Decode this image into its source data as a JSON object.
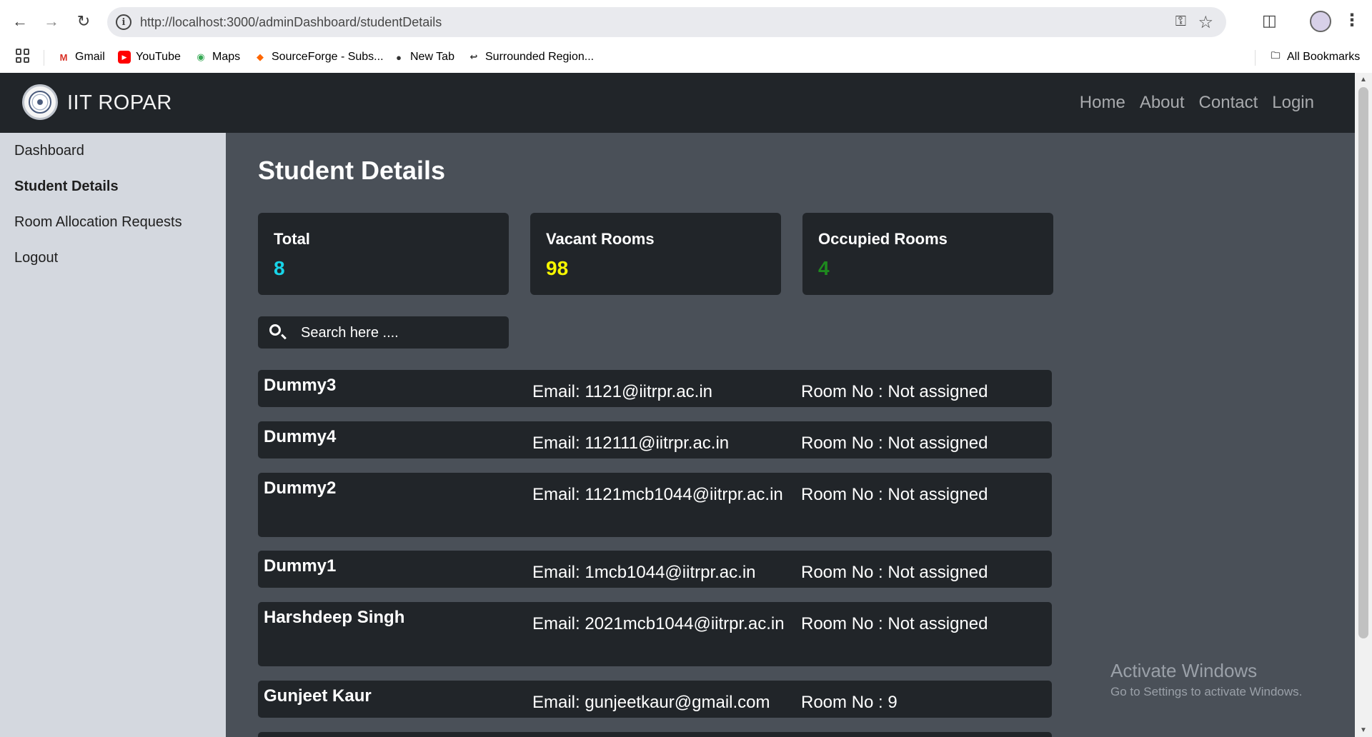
{
  "browser": {
    "url": "http://localhost:3000/adminDashboard/studentDetails",
    "bookmarks": [
      {
        "label": "Gmail",
        "icon": "gmail-icon",
        "color": "#d93025"
      },
      {
        "label": "YouTube",
        "icon": "youtube-icon",
        "color": "#ff0000"
      },
      {
        "label": "Maps",
        "icon": "maps-icon",
        "color": "#34a853"
      },
      {
        "label": "SourceForge - Subs...",
        "icon": "sourceforge-icon",
        "color": "#ff6600"
      },
      {
        "label": "New Tab",
        "icon": "globe-icon",
        "color": "#333333"
      },
      {
        "label": "Surrounded Region...",
        "icon": "leetcode-icon",
        "color": "#333333"
      }
    ],
    "all_bookmarks": "All Bookmarks"
  },
  "navbar": {
    "brand": "IIT ROPAR",
    "links": [
      "Home",
      "About",
      "Contact",
      "Login"
    ]
  },
  "sidebar": {
    "items": [
      {
        "label": "Dashboard",
        "active": false
      },
      {
        "label": "Student Details",
        "active": true
      },
      {
        "label": "Room Allocation Requests",
        "active": false
      },
      {
        "label": "Logout",
        "active": false
      }
    ]
  },
  "main": {
    "title": "Student Details",
    "stats": [
      {
        "label": "Total",
        "value": "8",
        "color": "#17d4e8"
      },
      {
        "label": "Vacant Rooms",
        "value": "98",
        "color": "#f5f500"
      },
      {
        "label": "Occupied Rooms",
        "value": "4",
        "color": "#1e8a1e"
      }
    ],
    "search_placeholder": "Search here ....",
    "students": [
      {
        "name": "Dummy3",
        "email": "Email: 1121@iitrpr.ac.in",
        "room": "Room No : Not assigned"
      },
      {
        "name": "Dummy4",
        "email": "Email: 112111@iitrpr.ac.in",
        "room": "Room No : Not assigned"
      },
      {
        "name": "Dummy2",
        "email": "Email: 1121mcb1044@iitrpr.ac.in",
        "room": "Room No : Not assigned"
      },
      {
        "name": "Dummy1",
        "email": "Email: 1mcb1044@iitrpr.ac.in",
        "room": "Room No : Not assigned"
      },
      {
        "name": "Harshdeep Singh",
        "email": "Email: 2021mcb1044@iitrpr.ac.in",
        "room": "Room No : Not assigned"
      },
      {
        "name": "Gunjeet Kaur",
        "email": "Email: gunjeetkaur@gmail.com",
        "room": "Room No : 9"
      }
    ]
  },
  "watermark": {
    "title": "Activate Windows",
    "subtitle": "Go to Settings to activate Windows."
  }
}
